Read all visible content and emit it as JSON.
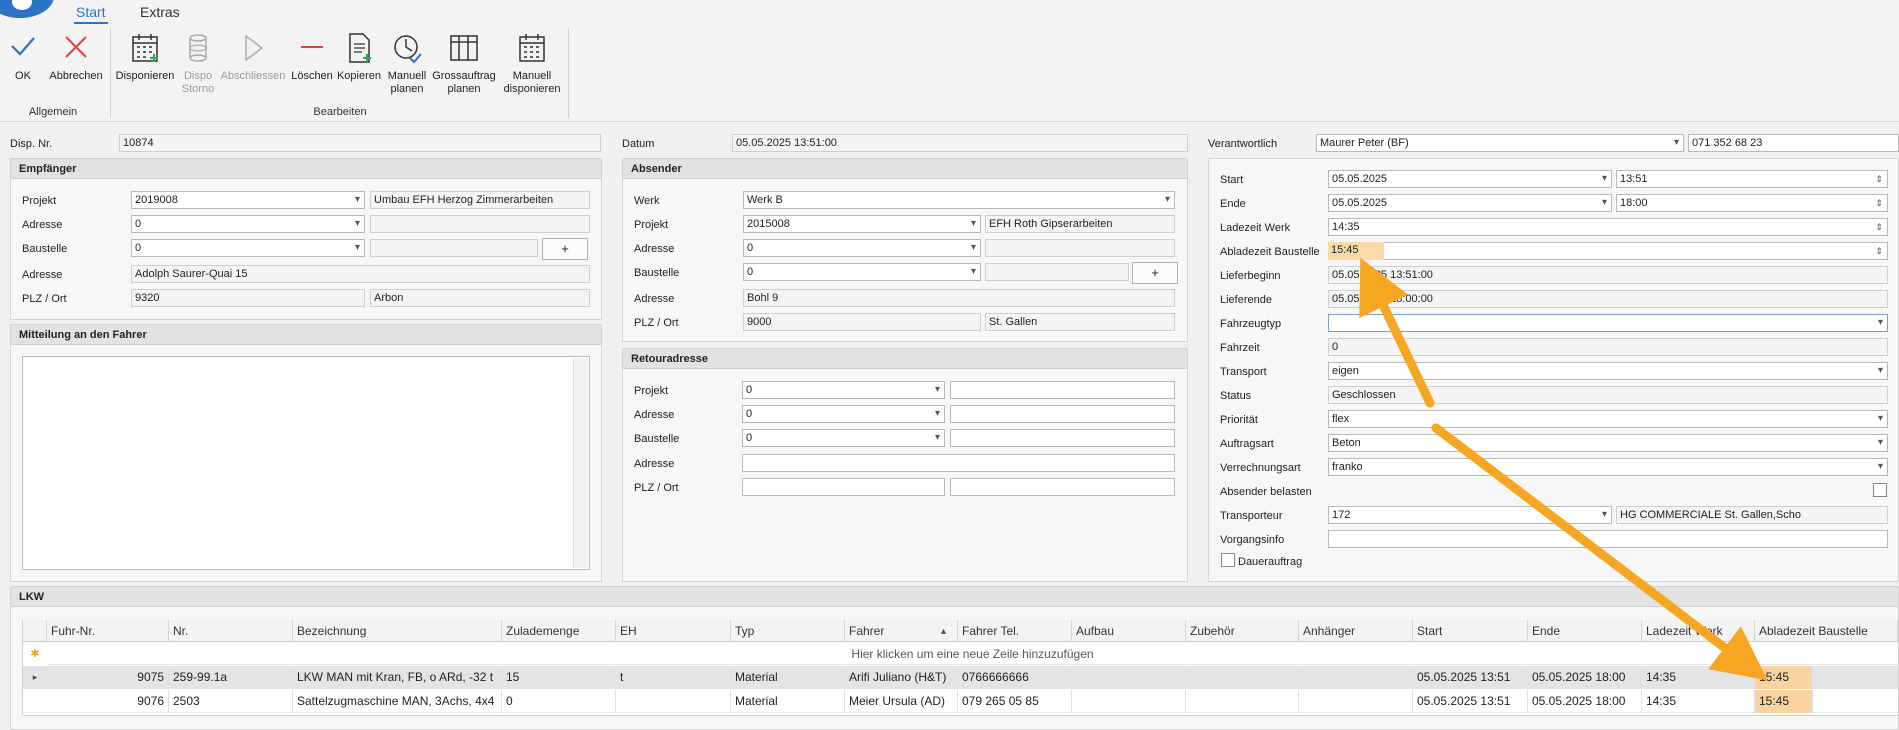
{
  "ribbon": {
    "tabs": [
      "Start",
      "Extras"
    ],
    "buttons": {
      "ok": "OK",
      "cancel": "Abbrechen",
      "disponieren": "Disponieren",
      "dispo_storno": "Dispo Storno",
      "abschliessen": "Abschliessen",
      "loeschen": "Löschen",
      "kopieren": "Kopieren",
      "manuell_planen": "Manuell planen",
      "grossauftrag_planen": "Grossauftrag planen",
      "manuell_disponieren": "Manuell disponieren"
    },
    "groups": {
      "allgemein": "Allgemein",
      "bearbeiten": "Bearbeiten"
    }
  },
  "header": {
    "dispo_nr_label": "Disp. Nr.",
    "dispo_nr": "10874",
    "datum_label": "Datum",
    "datum": "05.05.2025 13:51:00",
    "verantwortlich_label": "Verantwortlich",
    "verantwortlich": "Maurer Peter (BF)",
    "telefon": "071 352 68 23"
  },
  "empfaenger": {
    "title": "Empfänger",
    "projekt_label": "Projekt",
    "projekt": "2019008",
    "projekt_desc": "Umbau EFH Herzog Zimmerarbeiten",
    "adresse_label": "Adresse",
    "adresse": "0",
    "baustelle_label": "Baustelle",
    "baustelle": "0",
    "plus": "+",
    "adresse2_label": "Adresse",
    "adresse2": "Adolph Saurer-Quai 15",
    "plz_label": "PLZ / Ort",
    "plz": "9320",
    "ort": "Arbon"
  },
  "mitteilung": {
    "title": "Mitteilung an den Fahrer",
    "text": ""
  },
  "absender": {
    "title": "Absender",
    "werk_label": "Werk",
    "werk": "Werk B",
    "projekt_label": "Projekt",
    "projekt": "2015008",
    "projekt_desc": "EFH Roth Gipserarbeiten",
    "adresse_label": "Adresse",
    "adresse": "0",
    "baustelle_label": "Baustelle",
    "baustelle": "0",
    "plus": "+",
    "adresse2_label": "Adresse",
    "adresse2": "Bohl 9",
    "plz_label": "PLZ / Ort",
    "plz": "9000",
    "ort": "St. Gallen"
  },
  "retour": {
    "title": "Retouradresse",
    "projekt_label": "Projekt",
    "projekt": "0",
    "adresse_label": "Adresse",
    "adresse": "0",
    "baustelle_label": "Baustelle",
    "baustelle": "0",
    "adresse2_label": "Adresse",
    "plz_label": "PLZ / Ort"
  },
  "right": {
    "start_label": "Start",
    "start_date": "05.05.2025",
    "start_time": "13:51",
    "ende_label": "Ende",
    "ende_date": "05.05.2025",
    "ende_time": "18:00",
    "ladezeit_label": "Ladezeit Werk",
    "ladezeit": "14:35",
    "abladezeit_label": "Abladezeit Baustelle",
    "abladezeit": "15:45",
    "lieferbeginn_label": "Lieferbeginn",
    "lieferbeginn": "05.05.2025 13:51:00",
    "lieferende_label": "Lieferende",
    "lieferende": "05.05.2025 18:00:00",
    "fahrzeugtyp_label": "Fahrzeugtyp",
    "fahrzeugtyp": "",
    "fahrzeit_label": "Fahrzeit",
    "fahrzeit": "0",
    "transport_label": "Transport",
    "transport": "eigen",
    "status_label": "Status",
    "status": "Geschlossen",
    "prioritaet_label": "Priorität",
    "prioritaet": "flex",
    "auftragsart_label": "Auftragsart",
    "auftragsart": "Beton",
    "verrechnungsart_label": "Verrechnungsart",
    "verrechnungsart": "franko",
    "absender_belasten_label": "Absender belasten",
    "transporteur_label": "Transporteur",
    "transporteur": "172",
    "transporteur_name": "HG COMMERCIALE St. Gallen,Scho",
    "vorgangsinfo_label": "Vorgangsinfo",
    "vorgangsinfo": "",
    "dauerauftrag_label": "Dauerauftrag"
  },
  "lkw": {
    "title": "LKW",
    "new_row": "Hier klicken um eine neue Zeile hinzuzufügen",
    "columns": [
      "Fuhr-Nr.",
      "Nr.",
      "Bezeichnung",
      "Zulademenge",
      "EH",
      "Typ",
      "Fahrer",
      "Fahrer Tel.",
      "Aufbau",
      "Zubehör",
      "Anhänger",
      "Start",
      "Ende",
      "Ladezeit Werk",
      "Abladezeit Baustelle"
    ],
    "rows": [
      [
        "9075",
        "259-99.1a",
        "LKW MAN mit Kran, FB, o ARd, -32 t",
        "15",
        "t",
        "Material",
        "Arifi Juliano (H&T)",
        "0766666666",
        "",
        "",
        "",
        "05.05.2025 13:51",
        "05.05.2025 18:00",
        "14:35",
        "15:45"
      ],
      [
        "9076",
        "2503",
        "Sattelzugmaschine MAN, 3Achs, 4x4",
        "0",
        "",
        "Material",
        "Meier Ursula (AD)",
        "079 265 05 85",
        "",
        "",
        "",
        "05.05.2025 13:51",
        "05.05.2025 18:00",
        "14:35",
        "15:45"
      ]
    ]
  },
  "colors": {
    "accent": "#2b73c4",
    "highlight": "#fbd9a8",
    "arrow": "#f5a623"
  }
}
